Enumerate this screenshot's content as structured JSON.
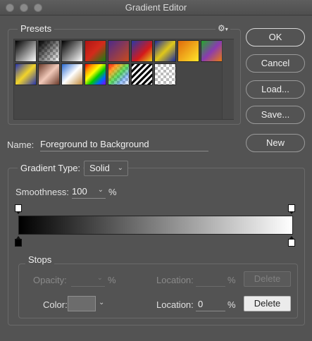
{
  "window": {
    "title": "Gradient Editor"
  },
  "presets": {
    "label": "Presets",
    "gear_icon": "gear-icon",
    "swatches": [
      "linear-gradient(135deg,#000 0%,#fff 100%)",
      "checker-black",
      "linear-gradient(135deg,#000 0%,#fff 100%)",
      "linear-gradient(135deg,#b01515 0%,#d32b1b 50%,#128012 100%)",
      "linear-gradient(135deg,#4d2a8a 0%,#c94a1c 100%)",
      "linear-gradient(135deg,#2a38a6 0%,#d51a1a 60%,#e8d21a 100%)",
      "linear-gradient(135deg,#1c2ba0 0%,#e0c81a 50%,#1c2ba0 100%)",
      "linear-gradient(135deg,#e06a0c 0%,#ffe62a 100%)",
      "linear-gradient(135deg,#22a82a 0%,#8a3bb0 50%,#e87a12 100%)",
      "linear-gradient(135deg,#2634b0 0%,#f2d42a 50%,#2634b0 100%)",
      "linear-gradient(135deg,#6b3a2a 0%,#f0c8b8 50%,#6b3a2a 100%)",
      "linear-gradient(135deg,#2a6ad0 0%,#ffffff 50%,#c08a3a 100%)",
      "linear-gradient(135deg,#ff0000,#ff9900,#ffff00,#00cc00,#0066ff,#8800ff)",
      "rainbow-checker",
      "stripes",
      "checker-plain"
    ]
  },
  "buttons": {
    "ok": "OK",
    "cancel": "Cancel",
    "load": "Load...",
    "save": "Save...",
    "new": "New"
  },
  "name": {
    "label": "Name:",
    "value": "Foreground to Background"
  },
  "gradient_type": {
    "legend": "Gradient Type:",
    "value": "Solid"
  },
  "smoothness": {
    "label": "Smoothness:",
    "value": "100",
    "unit": "%"
  },
  "gradient": {
    "start_color": "#000000",
    "end_color": "#ffffff"
  },
  "stops": {
    "legend": "Stops",
    "opacity_label": "Opacity:",
    "opacity_value": "",
    "opacity_unit": "%",
    "opacity_location_label": "Location:",
    "opacity_location_value": "",
    "opacity_location_unit": "%",
    "opacity_delete": "Delete",
    "color_label": "Color:",
    "color_location_label": "Location:",
    "color_location_value": "0",
    "color_location_unit": "%",
    "color_delete": "Delete"
  }
}
